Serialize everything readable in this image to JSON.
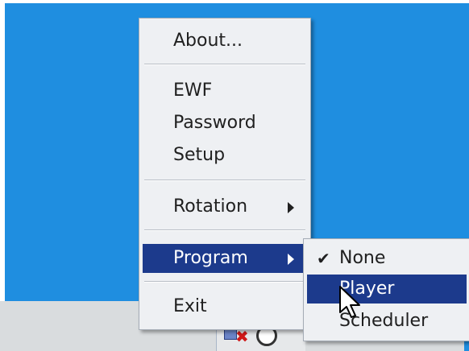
{
  "main_menu": {
    "items": [
      {
        "label": "About..."
      },
      {
        "label": "EWF"
      },
      {
        "label": "Password"
      },
      {
        "label": "Setup"
      },
      {
        "label": "Rotation",
        "has_submenu": true
      },
      {
        "label": "Program",
        "has_submenu": true,
        "highlighted": true
      },
      {
        "label": "Exit"
      }
    ]
  },
  "program_submenu": {
    "items": [
      {
        "label": "None",
        "checked": true
      },
      {
        "label": "Player",
        "highlighted": true
      },
      {
        "label": "Scheduler"
      }
    ]
  },
  "colors": {
    "desktop": "#1f8ee0",
    "menu_bg": "#eef0f3",
    "highlight": "#1c3a8c"
  },
  "icons": [
    "checkmark-icon",
    "submenu-arrow-icon",
    "mouse-pointer-icon",
    "tray-close-icon"
  ]
}
